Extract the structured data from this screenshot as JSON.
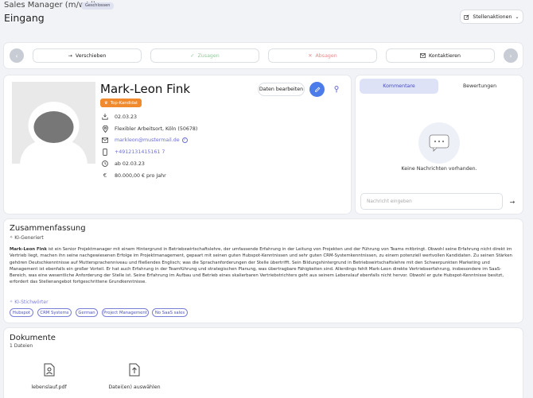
{
  "header": {
    "job_title": "Sales Manager (m/w/d)",
    "status_badge": "Geschlossen",
    "page_title": "Eingang",
    "job_actions_label": "Stellenaktionen"
  },
  "actions": {
    "move": "Verschieben",
    "accept": "Zusagen",
    "reject": "Absagen",
    "contact": "Kontaktieren"
  },
  "candidate": {
    "name": "Mark-Leon Fink",
    "badge": "Top-Kandidat",
    "edit_label": "Daten bearbeiten",
    "date_applied": "02.03.23",
    "location": "Flexibler Arbeitsort, Köln (50678)",
    "email": "markleon@mustermail.de",
    "phone": "+4912131415161 7",
    "availability": "ab 02.03.23",
    "salary": "80.000,00 € pro Jahr"
  },
  "comments": {
    "tab_comments": "Kommentare",
    "tab_ratings": "Bewertungen",
    "empty_text": "Keine Nachrichten vorhanden.",
    "input_placeholder": "Nachricht eingeben"
  },
  "summary": {
    "title": "Zusammenfassung",
    "ai_generated": "KI-Generiert",
    "name_bold": "Mark-Leon Fink",
    "lines": [
      " ist ein Senior Projektmanager mit einem Hintergrund in Betriebswirtschaftslehre, der umfassende Erfahrung in der Leitung von Projekten und der Führung von Teams mitbringt. Obwohl seine Erfahrung nicht direkt im",
      "Vertrieb liegt, machen ihn seine nachgewiesenen Erfolge im Projektmanagement, gepaart mit seinen guten Hubspot-Kenntnissen und sehr guten CRM-Systemkenntnissen, zu einem potenziell wertvollen Kandidaten. Zu seinen Stärken",
      "gehören Deutschkenntnisse auf Muttersprachenniveau und fließendes Englisch; was die Sprachanforderungen der Stelle übertrifft. Sein Bildungshintergrund in Betriebswirtschaftslehre mit den Schwerpunkten Marketing und",
      "Management ist ebenfalls ein großer Vorteil. Er hat auch Erfahrung in der Teamführung und strategischen Planung, was übertragbare Fähigkeiten sind. Allerdings fehlt Mark-Leon direkte Vertriebserfahrung, insbesondere im SaaS-",
      "Bereich, was eine wesentliche Anforderung der Stelle ist. Seine Erfahrung im Aufbau und Betrieb eines skalierbaren Vertriebstrichters geht aus seinem Lebenslauf ebenfalls nicht hervor. Obwohl er gute Hubspot-Kenntnisse besitzt,",
      "erfordert das Stellenangebot fortgeschrittene Grundkenntnisse."
    ],
    "keywords_label": "KI-Stichwörter",
    "keywords": [
      "Hubspot",
      "CRM Systems",
      "German",
      "Project Management",
      "No SaaS sales"
    ]
  },
  "documents": {
    "title": "Dokumente",
    "count": "1 Dateien",
    "file_name": "lebenslauf.pdf",
    "upload_label": "Datei(en) auswählen"
  }
}
